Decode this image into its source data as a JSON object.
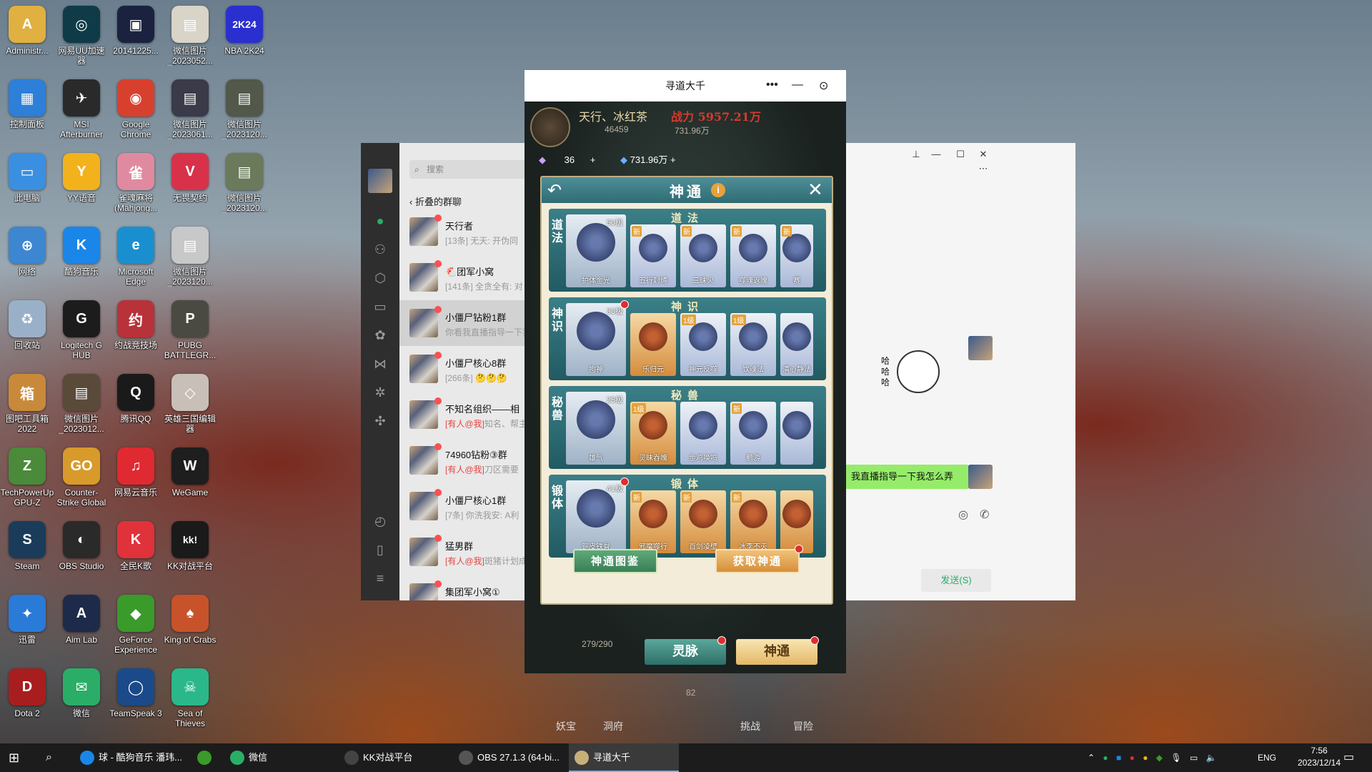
{
  "desktop_icons": [
    {
      "label": "Administr...",
      "color": "#e0b040",
      "glyph": "A"
    },
    {
      "label": "网易UU加速器",
      "color": "#0e3b47",
      "glyph": "◎"
    },
    {
      "label": "20141225...",
      "color": "#1a2240",
      "glyph": "▣"
    },
    {
      "label": "微信图片_2023052...",
      "color": "#d9d4c8",
      "glyph": "▤"
    },
    {
      "label": "NBA 2K24",
      "color": "#2a2fd0",
      "glyph": "2K24"
    },
    {
      "label": "控制面板",
      "color": "#2d7fd8",
      "glyph": "▦"
    },
    {
      "label": "MSI Afterburner",
      "color": "#2a2a2a",
      "glyph": "✈"
    },
    {
      "label": "Google Chrome",
      "color": "#d8402e",
      "glyph": "◉"
    },
    {
      "label": "微信图片_2023061...",
      "color": "#3a3a48",
      "glyph": "▤"
    },
    {
      "label": "微信图片_2023120...",
      "color": "#52584a",
      "glyph": "▤"
    },
    {
      "label": "此电脑",
      "color": "#3a8fe0",
      "glyph": "▭"
    },
    {
      "label": "YY语音",
      "color": "#f2b21c",
      "glyph": "Y"
    },
    {
      "label": "雀魂麻将(Mahjong...",
      "color": "#e08aa0",
      "glyph": "雀"
    },
    {
      "label": "无畏契约",
      "color": "#d8324a",
      "glyph": "V"
    },
    {
      "label": "微信图片_2023120...",
      "color": "#6a7a5a",
      "glyph": "▤"
    },
    {
      "label": "网络",
      "color": "#3d86d0",
      "glyph": "⊕"
    },
    {
      "label": "酷狗音乐",
      "color": "#1a86e8",
      "glyph": "K"
    },
    {
      "label": "Microsoft Edge",
      "color": "#1a8fd0",
      "glyph": "e"
    },
    {
      "label": "微信图片_2023120...",
      "color": "#c8c8c8",
      "glyph": "▤"
    },
    {
      "label": "回收站",
      "color": "#9ab0c8",
      "glyph": "♻"
    },
    {
      "label": "Logitech G HUB",
      "color": "#1c1c1c",
      "glyph": "G"
    },
    {
      "label": "约战竞技场",
      "color": "#b8323a",
      "glyph": "约"
    },
    {
      "label": "PUBG BATTLEGR...",
      "color": "#4a4a42",
      "glyph": "P"
    },
    {
      "label": "图吧工具箱2022",
      "color": "#c88a3a",
      "glyph": "箱"
    },
    {
      "label": "微信图片_2023012...",
      "color": "#5a4a3a",
      "glyph": "▤"
    },
    {
      "label": "腾讯QQ",
      "color": "#1a1a1a",
      "glyph": "Q"
    },
    {
      "label": "英雄三国编辑器",
      "color": "#c8c0b8",
      "glyph": "◇"
    },
    {
      "label": "TechPowerUp GPU-Z",
      "color": "#4a8a3a",
      "glyph": "Z"
    },
    {
      "label": "Counter-Strike Global Off...",
      "color": "#d89a2a",
      "glyph": "GO"
    },
    {
      "label": "网易云音乐",
      "color": "#e02a32",
      "glyph": "♫"
    },
    {
      "label": "WeGame",
      "color": "#1e1e1e",
      "glyph": "W"
    },
    {
      "label": "Steam",
      "color": "#1a3c5a",
      "glyph": "S"
    },
    {
      "label": "OBS Studio",
      "color": "#2a2a2a",
      "glyph": "◐"
    },
    {
      "label": "全民K歌",
      "color": "#e0323a",
      "glyph": "K"
    },
    {
      "label": "KK对战平台",
      "color": "#1a1a1a",
      "glyph": "kk!"
    },
    {
      "label": "迅雷",
      "color": "#2a7ad8",
      "glyph": "✦"
    },
    {
      "label": "Aim Lab",
      "color": "#1e2a4a",
      "glyph": "A"
    },
    {
      "label": "GeForce Experience",
      "color": "#3a9a2a",
      "glyph": "◆"
    },
    {
      "label": "King of Crabs",
      "color": "#c8522a",
      "glyph": "♠"
    },
    {
      "label": "Dota 2",
      "color": "#a81e1e",
      "glyph": "D"
    },
    {
      "label": "微信",
      "color": "#2aae67",
      "glyph": "✉"
    },
    {
      "label": "TeamSpeak 3",
      "color": "#1a4a8a",
      "glyph": "◯"
    },
    {
      "label": "Sea of Thieves",
      "color": "#2ab88a",
      "glyph": "☠"
    }
  ],
  "wechat": {
    "search_placeholder": "搜索",
    "folded_label": "折叠的群聊",
    "chats": [
      {
        "name": "天行者",
        "preview": "[13条] 无天: 开伪同",
        "at": ""
      },
      {
        "name": "🐔团军小窝",
        "preview": "[141条] 全贪全有: 对",
        "at": ""
      },
      {
        "name": "小僵尸钻粉1群",
        "preview": "你看我直播指导一下我",
        "at": ""
      },
      {
        "name": "小僵尸核心8群",
        "preview": "[266条] 🤔🤔🤔",
        "at": ""
      },
      {
        "name": "不知名组织——相",
        "preview": "知名、帮主",
        "at": "[有人@我]"
      },
      {
        "name": "74960钻粉③群",
        "preview": "刀区需要",
        "at": "[有人@我]"
      },
      {
        "name": "小僵尸核心1群",
        "preview": "[7条] 你洗我安: A利",
        "at": ""
      },
      {
        "name": "猛男群",
        "preview": "斑猪计划成",
        "at": "[有人@我]"
      },
      {
        "name": "集团军小窝①",
        "preview": "",
        "at": ""
      }
    ],
    "bubble_text": "我直播指导一下我怎么弄",
    "send_label": "发送(S)",
    "sticker_text": "哈哈哈"
  },
  "game": {
    "window_title": "寻道大千",
    "player_name": "天行、冰红茶",
    "combat_power": "战力 5957.21万",
    "res_top_1": "46459",
    "res_top_2": "731.96万",
    "res_gem": "36",
    "res_spirit": "731.96万",
    "panel_title": "神通",
    "rows": [
      {
        "head": "道法",
        "side": "道法",
        "main_name": "护体金光",
        "main_lv": "50级",
        "cards": [
          {
            "name": "五行封缚",
            "tag": "新"
          },
          {
            "name": "三昧火",
            "tag": "新"
          },
          {
            "name": "噬魂返魄",
            "tag": "新"
          },
          {
            "name": "赛",
            "tag": "新"
          }
        ]
      },
      {
        "head": "神识",
        "side": "神识",
        "main_name": "拘神",
        "main_lv": "30级",
        "cards": [
          {
            "name": "乐归元",
            "tag": ""
          },
          {
            "name": "神元反噬",
            "tag": "1级"
          },
          {
            "name": "饮魂法",
            "tag": "1级"
          },
          {
            "name": "清心静法",
            "tag": ""
          }
        ]
      },
      {
        "head": "秘兽",
        "side": "秘兽",
        "main_name": "雄气",
        "main_lv": "25级",
        "cards": [
          {
            "name": "灵昧吞魄",
            "tag": "1级"
          },
          {
            "name": "金鸡唤鸣",
            "tag": ""
          },
          {
            "name": "鹏游",
            "tag": "新"
          },
          {
            "name": "",
            "tag": ""
          }
        ]
      },
      {
        "head": "锻体",
        "side": "锻体",
        "main_name": "铜皮铁骨",
        "main_lv": "41级",
        "cards": [
          {
            "name": "邪魔噬行",
            "tag": "新"
          },
          {
            "name": "百剑凌壁",
            "tag": "新"
          },
          {
            "name": "冰李不灭",
            "tag": "新"
          },
          {
            "name": "",
            "tag": ""
          }
        ]
      }
    ],
    "btn_atlas": "神通图鉴",
    "btn_get": "获取神通",
    "tab_ling": "灵脉",
    "tab_shen": "神通",
    "progress_text": "279/290",
    "level_num": "82",
    "bottom_nav": [
      "妖宝",
      "洞府",
      "挑战",
      "冒险"
    ]
  },
  "taskbar": {
    "items": [
      {
        "label": "球 - 酷狗音乐 潘玮...",
        "color": "#1a86e8"
      },
      {
        "label": "",
        "color": "#3a9a2a"
      },
      {
        "label": "微信",
        "color": "#2aae67"
      },
      {
        "label": "KK对战平台",
        "color": "#444444"
      },
      {
        "label": "OBS 27.1.3 (64-bi...",
        "color": "#555555"
      },
      {
        "label": "寻道大千",
        "color": "#c8b07a"
      }
    ],
    "lang": "ENG",
    "time": "7:56",
    "date": "2023/12/14"
  }
}
